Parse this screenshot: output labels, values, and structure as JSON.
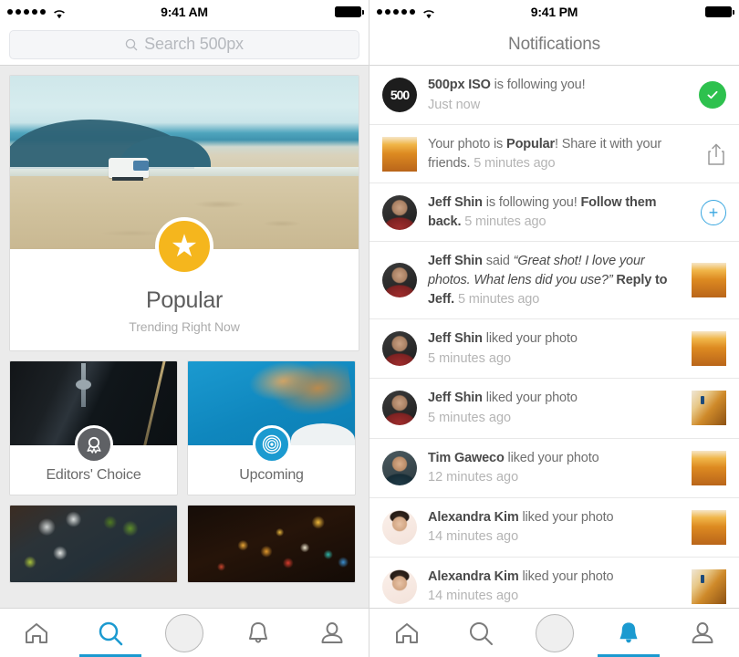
{
  "left": {
    "status": {
      "time": "9:41 AM",
      "signal_dots": 5,
      "wifi": "wifi-icon",
      "battery": "battery-full-icon"
    },
    "search": {
      "placeholder": "Search 500px",
      "value": "",
      "icon": "search-icon"
    },
    "cards": [
      {
        "title": "Popular",
        "subtitle": "Trending Right Now",
        "badge_icon": "star-icon",
        "badge_color": "#f5b61d",
        "photo": "beach-van-photo"
      },
      {
        "title": "Editors' Choice",
        "subtitle": "",
        "badge_icon": "ribbon-award-icon",
        "badge_color": "#5f6165",
        "photo": "city-tower-photo"
      },
      {
        "title": "Upcoming",
        "subtitle": "",
        "badge_icon": "target-rings-icon",
        "badge_color": "#1b9ad0",
        "photo": "blue-hair-photo"
      },
      {
        "title": "",
        "subtitle": "",
        "badge_icon": "",
        "badge_color": "",
        "photo": "food-utensils-photo"
      },
      {
        "title": "",
        "subtitle": "",
        "badge_icon": "",
        "badge_color": "",
        "photo": "bokeh-lights-photo"
      }
    ],
    "tabs": [
      {
        "name": "home",
        "icon": "home-icon",
        "active": false
      },
      {
        "name": "discover",
        "icon": "search-icon",
        "active": true
      },
      {
        "name": "camera",
        "icon": "camera-shutter-icon",
        "active": false
      },
      {
        "name": "notifications",
        "icon": "bell-icon",
        "active": false
      },
      {
        "name": "profile",
        "icon": "person-icon",
        "active": false
      }
    ]
  },
  "right": {
    "status": {
      "time": "9:41 PM",
      "signal_dots": 5,
      "wifi": "wifi-icon",
      "battery": "battery-full-icon"
    },
    "header": {
      "title": "Notifications"
    },
    "notifications": [
      {
        "avatar": "500px-logo-avatar",
        "avatar_label": "500",
        "actor": "500px ISO",
        "text_rest": " is following you!",
        "cta": "",
        "time": "Just now",
        "time_inline": false,
        "action": "accept-check-button",
        "action_icon": "check-icon"
      },
      {
        "avatar": "photo-thumbnail",
        "avatar_label": "",
        "actor": "",
        "text_lead": "Your photo is ",
        "bold_mid": "Popular",
        "text_rest": "! Share it with your friends. ",
        "cta": "",
        "time": "5 minutes ago",
        "time_inline": true,
        "action": "share-button",
        "action_icon": "share-icon"
      },
      {
        "avatar": "jeff-shin-avatar",
        "avatar_label": "",
        "actor": "Jeff Shin",
        "text_rest": " is following you! ",
        "cta": "Follow them back.",
        "text_after_cta": " ",
        "time": "5 minutes ago",
        "time_inline": true,
        "action": "follow-back-button",
        "action_icon": "plus-icon"
      },
      {
        "avatar": "jeff-shin-avatar",
        "avatar_label": "",
        "actor": "Jeff Shin",
        "text_rest": " said ",
        "quote": "“Great shot! I love your photos. What lens did you use?”",
        "cta": " Reply to Jeff.",
        "text_after_cta": " ",
        "time": "5 minutes ago",
        "time_inline": true,
        "action": "photo-thumbnail",
        "action_icon": "dune-photo-1"
      },
      {
        "avatar": "jeff-shin-avatar",
        "avatar_label": "",
        "actor": "Jeff Shin",
        "text_rest": " liked your photo",
        "cta": "",
        "time": "5 minutes ago",
        "time_inline": false,
        "action": "photo-thumbnail",
        "action_icon": "dune-photo-1"
      },
      {
        "avatar": "jeff-shin-avatar",
        "avatar_label": "",
        "actor": "Jeff Shin",
        "text_rest": " liked your photo",
        "cta": "",
        "time": "5 minutes ago",
        "time_inline": false,
        "action": "photo-thumbnail",
        "action_icon": "dune-photo-2"
      },
      {
        "avatar": "tim-gaweco-avatar",
        "avatar_label": "",
        "actor": "Tim Gaweco",
        "text_rest": " liked your photo",
        "cta": "",
        "time": "12 minutes ago",
        "time_inline": false,
        "action": "photo-thumbnail",
        "action_icon": "dune-photo-1"
      },
      {
        "avatar": "alexandra-kim-avatar",
        "avatar_label": "",
        "actor": "Alexandra Kim",
        "text_rest": " liked your photo",
        "cta": "",
        "time": "14 minutes ago",
        "time_inline": false,
        "action": "photo-thumbnail",
        "action_icon": "dune-photo-1"
      },
      {
        "avatar": "alexandra-kim-avatar",
        "avatar_label": "",
        "actor": "Alexandra Kim",
        "text_rest": " liked your photo",
        "cta": "",
        "time": "14 minutes ago",
        "time_inline": false,
        "action": "photo-thumbnail",
        "action_icon": "dune-photo-2"
      }
    ],
    "tabs": [
      {
        "name": "home",
        "icon": "home-icon",
        "active": false
      },
      {
        "name": "discover",
        "icon": "search-icon",
        "active": false
      },
      {
        "name": "camera",
        "icon": "camera-shutter-icon",
        "active": false
      },
      {
        "name": "notifications",
        "icon": "bell-icon",
        "active": true
      },
      {
        "name": "profile",
        "icon": "person-icon",
        "active": false
      }
    ]
  },
  "colors": {
    "accent_blue": "#1b9ad0",
    "accent_green": "#2ec14e",
    "accent_yellow": "#f5b61d",
    "text_primary": "#4a4a4a",
    "text_secondary": "#6f6f6f",
    "text_muted": "#b4b4b4",
    "panel_bg": "#ebebeb"
  }
}
